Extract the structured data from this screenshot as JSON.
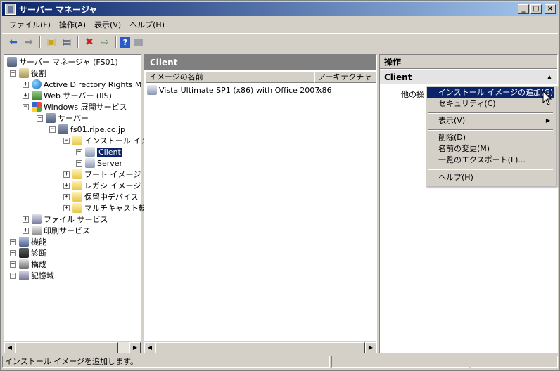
{
  "window": {
    "title": "サーバー マネージャ"
  },
  "menubar": [
    "ファイル(F)",
    "操作(A)",
    "表示(V)",
    "ヘルプ(H)"
  ],
  "tree": {
    "root": "サーバー マネージャ (FS01)",
    "roles": "役割",
    "adrms": "Active Directory Rights M",
    "web": "Web サーバー (IIS)",
    "wds": "Windows 展開サービス",
    "servers": "サーバー",
    "host": "fs01.ripe.co.jp",
    "install_images": "インストール イメ",
    "client": "Client",
    "server": "Server",
    "boot_images": "ブート イメージ",
    "legacy_images": "レガシ イメージ",
    "pending_devices": "保留中デバイス",
    "multicast": "マルチキャスト転",
    "file_services": "ファイル サービス",
    "print_services": "印刷サービス",
    "features": "機能",
    "diagnostics": "診断",
    "configuration": "構成",
    "storage": "記憶域"
  },
  "middle": {
    "title": "Client",
    "columns": [
      "イメージの名前",
      "アーキテクチャ"
    ],
    "rows": [
      {
        "name": "Vista Ultimate SP1 (x86) with Office 2007",
        "arch": "x86"
      }
    ]
  },
  "actions": {
    "title": "操作",
    "section": "Client",
    "item": "他の操"
  },
  "context_menu": {
    "add_image": "インストール イメージの追加(G)",
    "security": "セキュリティ(C)",
    "view": "表示(V)",
    "delete": "削除(D)",
    "rename": "名前の変更(M)",
    "export": "一覧のエクスポート(L)...",
    "help": "ヘルプ(H)"
  },
  "status": {
    "text": "インストール イメージを追加します。"
  }
}
